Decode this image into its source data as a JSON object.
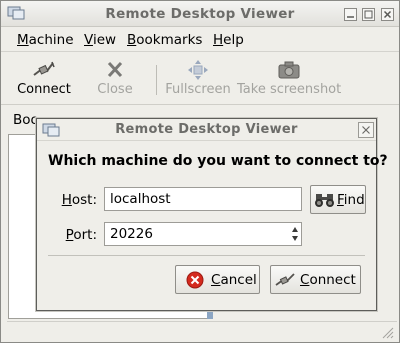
{
  "window": {
    "title": "Remote Desktop Viewer",
    "icon": "remote-desktop-icon"
  },
  "menubar": {
    "items": [
      {
        "first": "M",
        "rest": "achine"
      },
      {
        "first": "V",
        "rest": "iew"
      },
      {
        "first": "B",
        "rest": "ookmarks"
      },
      {
        "first": "H",
        "rest": "elp"
      }
    ]
  },
  "toolbar": {
    "connect": "Connect",
    "close": "Close",
    "fullscreen": "Fullscreen",
    "screenshot": "Take screenshot"
  },
  "sidebar": {
    "label": "Boo"
  },
  "dialog": {
    "title": "Remote Desktop Viewer",
    "question": "Which machine do you want to connect to?",
    "host_label_first": "H",
    "host_label_rest": "ost:",
    "host_value": "localhost",
    "find_first": "F",
    "find_rest": "ind",
    "port_label_first": "P",
    "port_label_rest": "ort:",
    "port_value": "20226",
    "cancel_first": "C",
    "cancel_rest": "ancel",
    "connect_first": "C",
    "connect_rest": "onnect"
  },
  "colors": {
    "window_bg": "#efeee9",
    "divider": "#8ba5c3",
    "cancel_red": "#d42a1e"
  }
}
